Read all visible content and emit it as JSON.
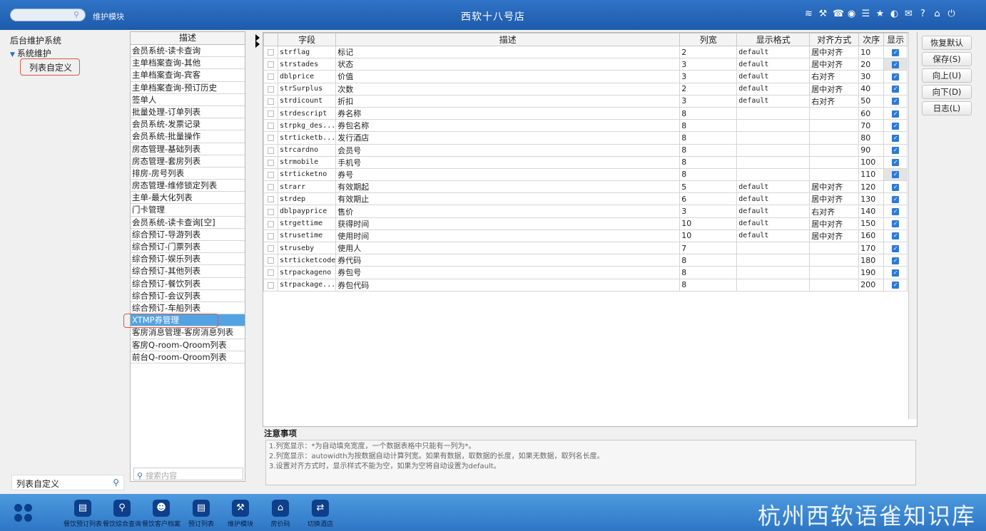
{
  "topbar": {
    "module_label": "维护模块",
    "title": "西软十八号店",
    "icons": [
      "wifi-icon",
      "tools-icon",
      "phone-icon",
      "palette-icon",
      "menu-icon",
      "star-icon",
      "contrast-icon",
      "mail-icon",
      "help-icon",
      "home-icon",
      "power-icon"
    ]
  },
  "tree": {
    "root": "后台维护系统",
    "node": "系统维护",
    "leaf": "列表自定义"
  },
  "left_search": "列表自定义",
  "mid": {
    "header": "描述",
    "search_placeholder": "搜索内容",
    "items": [
      "会员系统-读卡查询",
      "主单档案查询-其他",
      "主单档案查询-宾客",
      "主单档案查询-预订历史",
      "签单人",
      "批量处理-订单列表",
      "会员系统-发票记录",
      "会员系统-批量操作",
      "房态管理-基础列表",
      "房态管理-套房列表",
      "排房-房号列表",
      "房态管理-维修锁定列表",
      "主单-最大化列表",
      "门卡管理",
      "会员系统-读卡查询[空]",
      "综合预订-导游列表",
      "综合预订-门票列表",
      "综合预订-娱乐列表",
      "综合预订-其他列表",
      "综合预订-餐饮列表",
      "综合预订-会议列表",
      "综合预订-车船列表",
      "XTMP券管理",
      "客房消息管理-客房消息列表",
      "客房Q-room-Qroom列表",
      "前台Q-room-Qroom列表"
    ]
  },
  "grid": {
    "headers": {
      "field": "字段",
      "desc": "描述",
      "width": "列宽",
      "format": "显示格式",
      "align": "对齐方式",
      "order": "次序",
      "show": "显示"
    },
    "rows": [
      {
        "field": "strflag",
        "desc": "标记",
        "width": "2",
        "format": "default",
        "align": "居中对齐",
        "order": "10"
      },
      {
        "field": "strstades",
        "desc": "状态",
        "width": "3",
        "format": "default",
        "align": "居中对齐",
        "order": "20"
      },
      {
        "field": "dblprice",
        "desc": "价值",
        "width": "3",
        "format": "default",
        "align": "右对齐",
        "order": "30"
      },
      {
        "field": "strSurplus",
        "desc": "次数",
        "width": "2",
        "format": "default",
        "align": "居中对齐",
        "order": "40"
      },
      {
        "field": "strdicount",
        "desc": "折扣",
        "width": "3",
        "format": "default",
        "align": "右对齐",
        "order": "50"
      },
      {
        "field": "strdescript",
        "desc": "券名称",
        "width": "8",
        "format": "",
        "align": "",
        "order": "60"
      },
      {
        "field": "strpkg_des...",
        "desc": "券包名称",
        "width": "8",
        "format": "",
        "align": "",
        "order": "70"
      },
      {
        "field": "strticketb...",
        "desc": "发行酒店",
        "width": "8",
        "format": "",
        "align": "",
        "order": "80"
      },
      {
        "field": "strcardno",
        "desc": "会员号",
        "width": "8",
        "format": "",
        "align": "",
        "order": "90"
      },
      {
        "field": "strmobile",
        "desc": "手机号",
        "width": "8",
        "format": "",
        "align": "",
        "order": "100"
      },
      {
        "field": "strticketno",
        "desc": "券号",
        "width": "8",
        "format": "",
        "align": "",
        "order": "110"
      },
      {
        "field": "strarr",
        "desc": "有效期起",
        "width": "5",
        "format": "default",
        "align": "居中对齐",
        "order": "120"
      },
      {
        "field": "strdep",
        "desc": "有效期止",
        "width": "6",
        "format": "default",
        "align": "居中对齐",
        "order": "130"
      },
      {
        "field": "dblpayprice",
        "desc": "售价",
        "width": "3",
        "format": "default",
        "align": "右对齐",
        "order": "140"
      },
      {
        "field": "strgettime",
        "desc": "获得时间",
        "width": "10",
        "format": "default",
        "align": "居中对齐",
        "order": "150"
      },
      {
        "field": "strusetime",
        "desc": "使用时间",
        "width": "10",
        "format": "default",
        "align": "居中对齐",
        "order": "160"
      },
      {
        "field": "struseby",
        "desc": "使用人",
        "width": "7",
        "format": "",
        "align": "",
        "order": "170"
      },
      {
        "field": "strticketcode",
        "desc": "券代码",
        "width": "8",
        "format": "",
        "align": "",
        "order": "180"
      },
      {
        "field": "strpackageno",
        "desc": "券包号",
        "width": "8",
        "format": "",
        "align": "",
        "order": "190"
      },
      {
        "field": "strpackage...",
        "desc": "券包代码",
        "width": "8",
        "format": "",
        "align": "",
        "order": "200"
      }
    ]
  },
  "notes": {
    "title": "注意事项",
    "lines": [
      "1.列宽显示：*为自动填充宽度，一个数据表格中只能有一列为*。",
      "2.列宽显示：autowidth为按数据自动计算列宽。如果有数据，取数据的长度，如果无数据，取列名长度。",
      "3.设置对齐方式时，显示样式不能为空，如果为空将自动设置为default。"
    ]
  },
  "buttons": {
    "restore": "恢复默认",
    "save": "保存(S)",
    "up": "向上(U)",
    "down": "向下(D)",
    "log": "日志(L)"
  },
  "taskbar": {
    "items": [
      "餐饮预订列表",
      "餐饮综合查询",
      "餐饮客户档案",
      "预订列表",
      "维护模块",
      "房价码",
      "切换酒店"
    ],
    "watermark": "杭州西软语雀知识库"
  }
}
